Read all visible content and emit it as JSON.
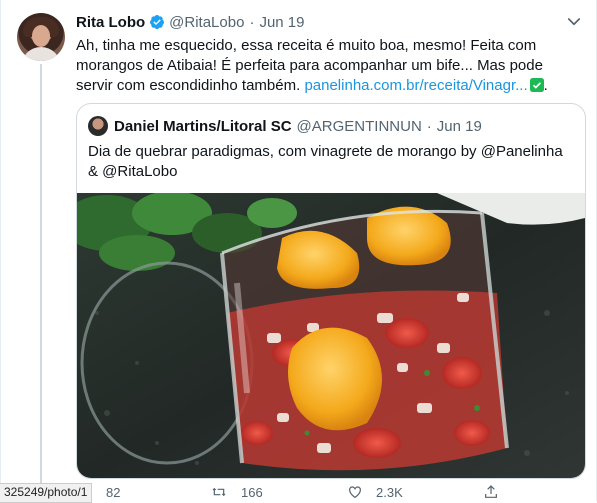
{
  "tweet": {
    "author_name": "Rita Lobo",
    "handle": "@RitaLobo",
    "separator": "·",
    "date": "Jun 19",
    "text": "Ah, tinha me esquecido, essa receita é muito boa, mesmo! Feita com morangos de Atibaia! É perfeita para acompanhar um bife... Mas pode servir com escondidinho também.",
    "link": "panelinha.com.br/receita/Vinagr...",
    "trailing": "."
  },
  "quote": {
    "author_name": "Daniel Martins/Litoral SC",
    "handle": "@ARGENTINNUN",
    "separator": "·",
    "date": "Jun 19",
    "text": "Dia de quebrar paradigmas, com vinagrete de morango by @Panelinha & @RitaLobo"
  },
  "actions": {
    "replies": "82",
    "retweets": "166",
    "likes": "2.3K"
  },
  "status_url": "325249/photo/1",
  "colors": {
    "link": "#1b95e0",
    "verified": "#1da1f2",
    "badge_green": "#1db954",
    "border": "#cfd9de"
  }
}
